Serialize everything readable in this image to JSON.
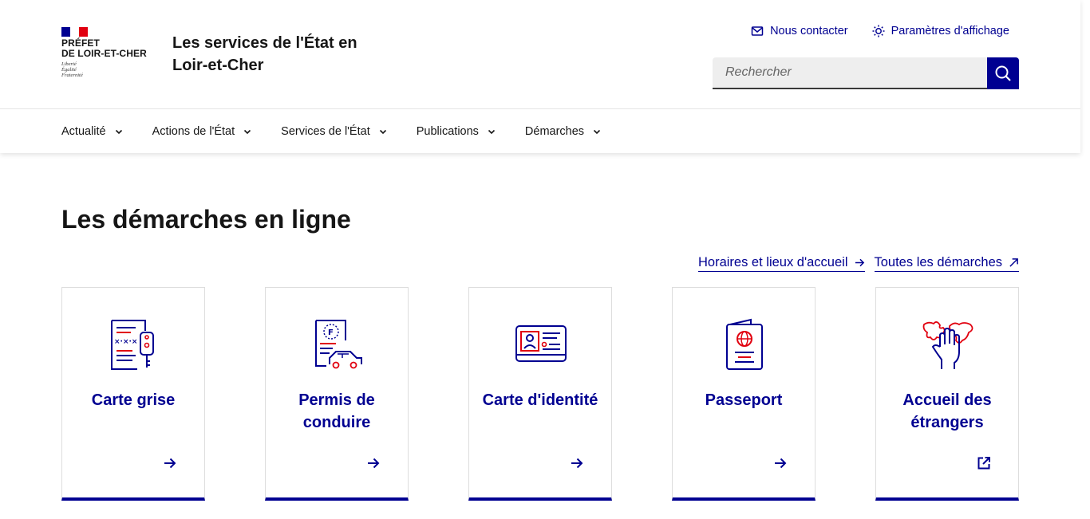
{
  "header": {
    "logo": {
      "line1": "PRÉFET",
      "line2": "DE LOIR-ET-CHER",
      "devise1": "Liberté",
      "devise2": "Égalité",
      "devise3": "Fraternité"
    },
    "service_title": "Les services de l'État en Loir-et-Cher",
    "tools": {
      "contact_label": "Nous contacter",
      "display_label": "Paramètres d'affichage"
    },
    "search": {
      "placeholder": "Rechercher"
    }
  },
  "nav": {
    "items": [
      {
        "label": "Actualité"
      },
      {
        "label": "Actions de l'État"
      },
      {
        "label": "Services de l'État"
      },
      {
        "label": "Publications"
      },
      {
        "label": "Démarches"
      }
    ]
  },
  "main": {
    "title": "Les démarches en ligne",
    "links": {
      "horaires": "Horaires et lieux d'accueil",
      "toutes": "Toutes les démarches"
    },
    "cards": [
      {
        "title": "Carte grise",
        "icon": "vehicle-registration-icon",
        "action_icon": "arrow-right-icon"
      },
      {
        "title": "Permis de conduire",
        "icon": "driving-licence-icon",
        "action_icon": "arrow-right-icon"
      },
      {
        "title": "Carte d'identité",
        "icon": "id-card-icon",
        "action_icon": "arrow-right-icon"
      },
      {
        "title": "Passeport",
        "icon": "passport-icon",
        "action_icon": "arrow-right-icon"
      },
      {
        "title": "Accueil des étrangers",
        "icon": "foreigners-welcome-icon",
        "action_icon": "external-link-icon"
      }
    ]
  },
  "colors": {
    "primary": "#000091",
    "accent_red": "#e1000f",
    "text": "#161616"
  }
}
